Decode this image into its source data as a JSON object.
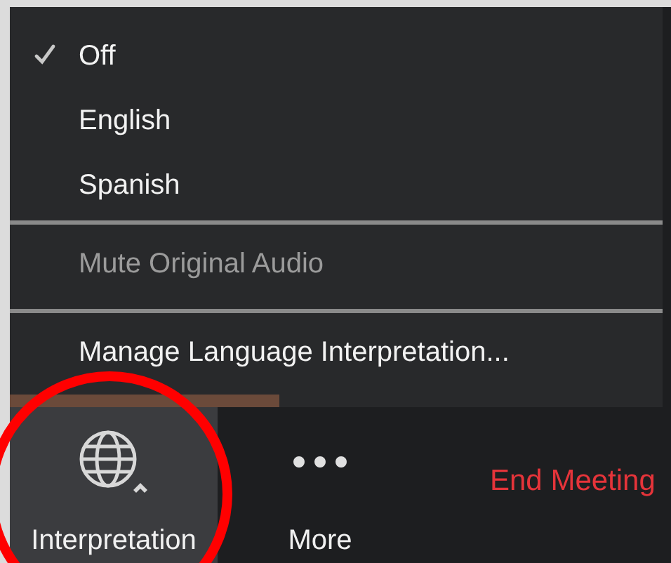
{
  "menu": {
    "languages": [
      {
        "label": "Off",
        "selected": true
      },
      {
        "label": "English",
        "selected": false
      },
      {
        "label": "Spanish",
        "selected": false
      }
    ],
    "actions": [
      {
        "label": "Mute Original Audio",
        "disabled": true
      },
      {
        "label": "Manage Language Interpretation...",
        "disabled": false
      }
    ]
  },
  "toolbar": {
    "buttons": [
      {
        "label": "Interpretation",
        "kind": "globe",
        "highlighted": true
      },
      {
        "label": "More",
        "kind": "more",
        "highlighted": false
      }
    ],
    "end_button": "End Meeting"
  }
}
